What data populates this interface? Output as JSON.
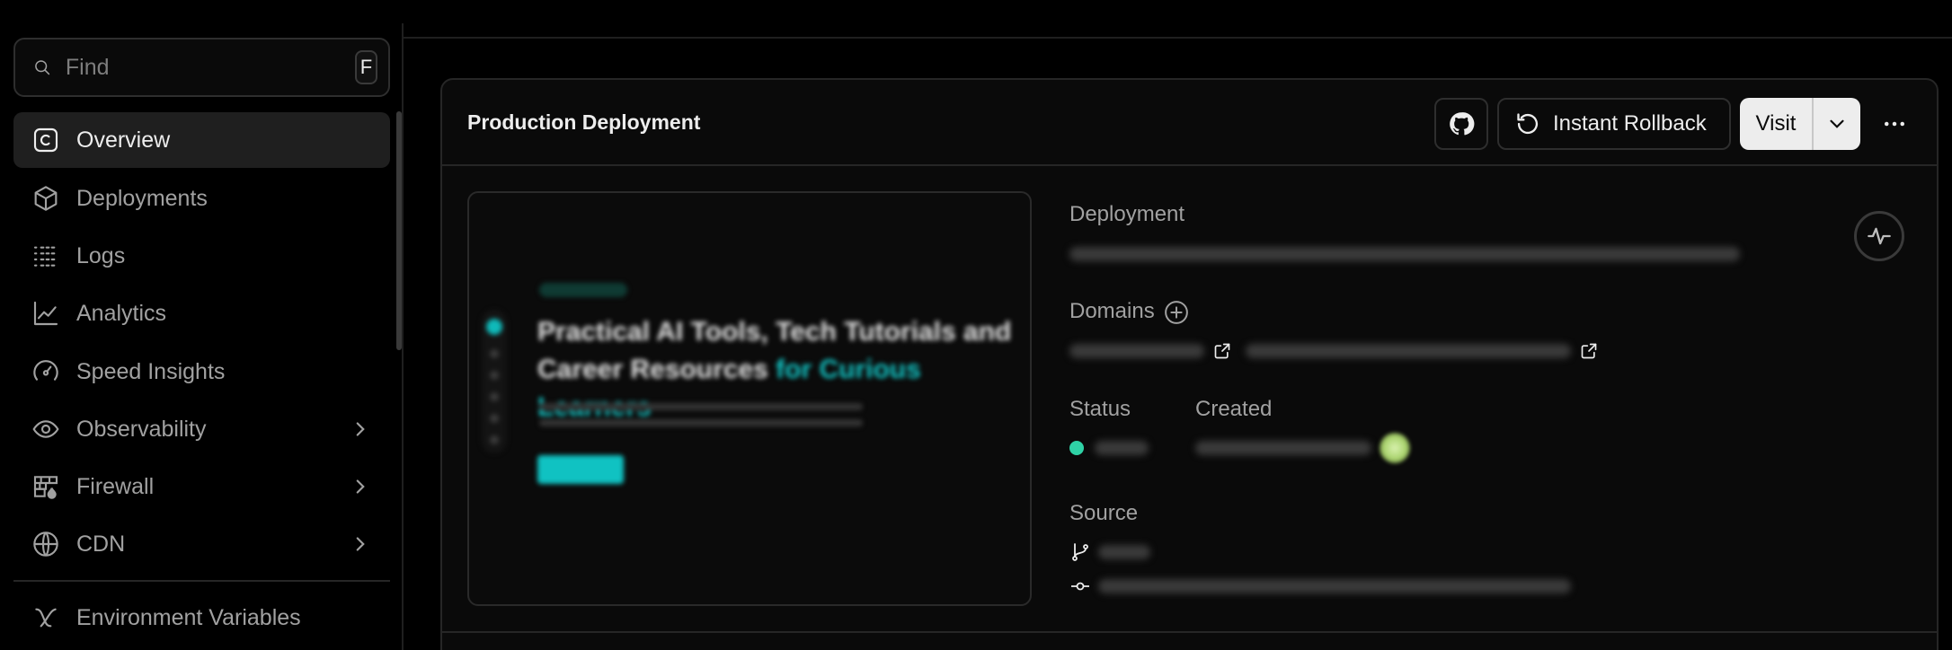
{
  "sidebar": {
    "find": {
      "placeholder": "Find",
      "shortcut": "F"
    },
    "items": [
      {
        "label": "Overview",
        "icon": "overview-icon",
        "active": true
      },
      {
        "label": "Deployments",
        "icon": "cube-icon"
      },
      {
        "label": "Logs",
        "icon": "logs-list-icon"
      },
      {
        "label": "Analytics",
        "icon": "line-chart-icon"
      },
      {
        "label": "Speed Insights",
        "icon": "gauge-icon"
      },
      {
        "label": "Observability",
        "icon": "eye-icon",
        "has_submenu": true
      },
      {
        "label": "Firewall",
        "icon": "firewall-icon",
        "has_submenu": true
      },
      {
        "label": "CDN",
        "icon": "globe-icon",
        "has_submenu": true
      },
      {
        "label": "Environment Variables",
        "icon": "variable-icon"
      }
    ]
  },
  "card": {
    "title": "Production Deployment",
    "actions": {
      "github_icon": "github-icon",
      "rollback_label": "Instant Rollback",
      "visit_label": "Visit"
    },
    "preview": {
      "headline_main": "Practical AI Tools, Tech Tutorials and Career Resources ",
      "headline_accent": "for Curious Learners"
    },
    "labels": {
      "deployment": "Deployment",
      "domains": "Domains",
      "status": "Status",
      "created": "Created",
      "source": "Source"
    }
  },
  "colors": {
    "background": "#000000",
    "accent_teal": "#12c6c6",
    "status_ready": "#2fd2a6"
  }
}
